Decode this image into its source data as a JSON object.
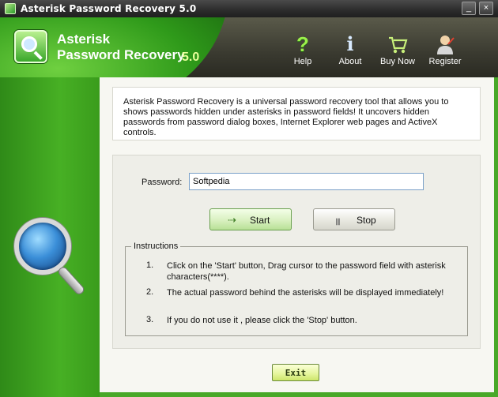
{
  "window": {
    "title": "Asterisk Password Recovery 5.0",
    "minimize": "_",
    "close": "×"
  },
  "header": {
    "brand_line1": "Asterisk",
    "brand_line2": "Password Recovery",
    "version": "5.0",
    "nav": [
      {
        "label": "Help",
        "icon": "help-icon"
      },
      {
        "label": "About",
        "icon": "info-icon"
      },
      {
        "label": "Buy Now",
        "icon": "cart-icon"
      },
      {
        "label": "Register",
        "icon": "user-icon"
      }
    ]
  },
  "description": "Asterisk Password Recovery is a universal password recovery tool that allows you to shows passwords hidden under asterisks in password fields! It uncovers hidden passwords from password dialog boxes, Internet Explorer web pages and ActiveX controls.",
  "form": {
    "password_label": "Password:",
    "password_value": "Softpedia",
    "start_label": "Start",
    "stop_label": "Stop"
  },
  "instructions": {
    "title": "Instructions",
    "items": [
      {
        "num": "1.",
        "text": "Click on the 'Start' button, Drag cursor to the password field with asterisk characters(****)."
      },
      {
        "num": "2.",
        "text": "The actual password behind the asterisks will be displayed immediately!"
      },
      {
        "num": "3.",
        "text": "If you do not  use it , please click the 'Stop' button."
      }
    ]
  },
  "footer": {
    "exit_label": "Exit"
  },
  "colors": {
    "brand_green": "#47b024",
    "header_dark": "#3a3a30",
    "accent_yellow": "#e8ff9a"
  }
}
